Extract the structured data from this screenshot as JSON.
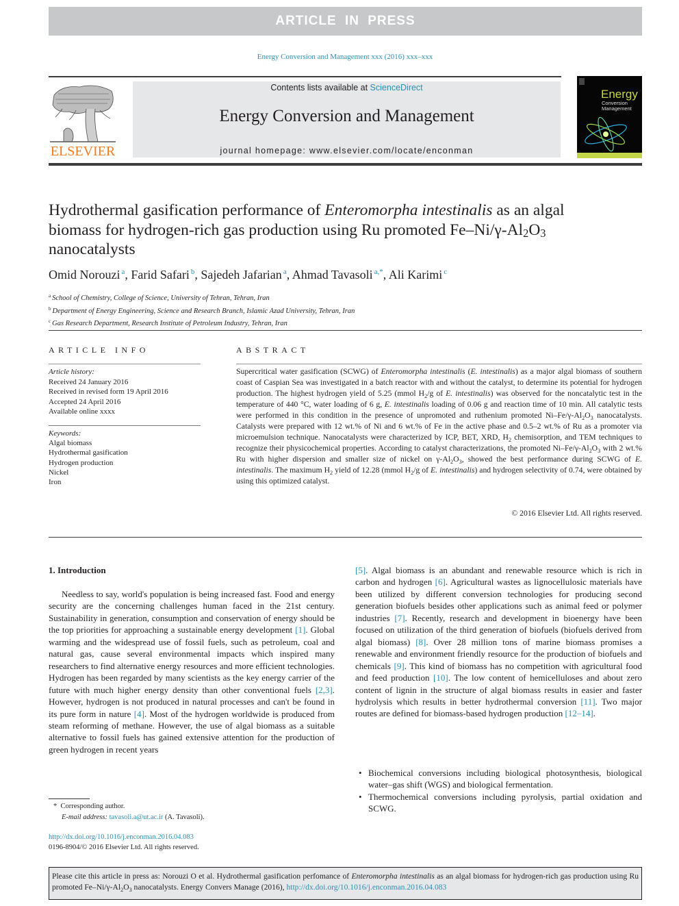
{
  "banner": "ARTICLE IN PRESS",
  "journal_ref": "Energy Conversion and Management xxx (2016) xxx–xxx",
  "header": {
    "contents_prefix": "Contents lists available at ",
    "contents_link": "ScienceDirect",
    "journal_title": "Energy Conversion and Management",
    "homepage_prefix": "journal homepage: ",
    "homepage_url": "www.elsevier.com/locate/enconman",
    "publisher_logo": "ELSEVIER",
    "cover": {
      "line1": "Energy",
      "line2": "Conversion",
      "line3": "Management"
    }
  },
  "colors": {
    "link": "#2a8fb5",
    "elsevier_orange": "#f47b20",
    "banner_gray": "#c7c8ca",
    "box_gray": "#e6e7e8"
  },
  "article": {
    "title_part1": "Hydrothermal gasification performance of ",
    "title_italic": "Enteromorpha intestinalis",
    "title_part2": " as an algal biomass for hydrogen-rich gas production using Ru promoted Fe–Ni/γ-Al",
    "title_sub1": "2",
    "title_mid": "O",
    "title_sub2": "3",
    "title_end": " nanocatalysts",
    "authors": [
      {
        "name": "Omid Norouzi",
        "aff": "a"
      },
      {
        "name": "Farid Safari",
        "aff": "b"
      },
      {
        "name": "Sajedeh Jafarian",
        "aff": "a"
      },
      {
        "name": "Ahmad Tavasoli",
        "aff": "a,*"
      },
      {
        "name": "Ali Karimi",
        "aff": "c"
      }
    ],
    "affiliations": [
      {
        "key": "a",
        "text": "School of Chemistry, College of Science, University of Tehran, Tehran, Iran"
      },
      {
        "key": "b",
        "text": "Department of Energy Engineering, Science and Research Branch, Islamic Azad University, Tehran, Iran"
      },
      {
        "key": "c",
        "text": "Gas Research Department, Research Institute of Petroleum Industry, Tehran, Iran"
      }
    ]
  },
  "article_info": {
    "heading": "ARTICLE INFO",
    "history_label": "Article history:",
    "history": [
      "Received 24 January 2016",
      "Received in revised form 19 April 2016",
      "Accepted 24 April 2016",
      "Available online xxxx"
    ],
    "keywords_label": "Keywords:",
    "keywords": [
      "Algal biomass",
      "Hydrothermal gasification",
      "Hydrogen production",
      "Nickel",
      "Iron"
    ]
  },
  "abstract": {
    "heading": "ABSTRACT",
    "copyright": "© 2016 Elsevier Ltd. All rights reserved."
  },
  "introduction": {
    "heading": "1. Introduction",
    "refs": [
      "[1]",
      "[2,3]",
      "[4]",
      "[5]",
      "[6]",
      "[7]",
      "[8]",
      "[9]",
      "[10]",
      "[11]",
      "[12–14]"
    ],
    "bullets": [
      "Biochemical conversions including biological photosynthesis, biological water–gas shift (WGS) and biological fermentation.",
      "Thermochemical conversions including pyrolysis, partial oxidation and SCWG."
    ]
  },
  "footnote": {
    "marker": "*",
    "corresponding": "Corresponding author.",
    "email_label": "E-mail address:",
    "email": "tavasoli.a@ut.ac.ir",
    "email_owner": "(A. Tavasoli).",
    "doi": "http://dx.doi.org/10.1016/j.enconman.2016.04.083",
    "issn_copyright": "0196-8904/© 2016 Elsevier Ltd. All rights reserved."
  },
  "citation_box": {
    "prefix": "Please cite this article in press as: Norouzi O et al. Hydrothermal gasification perfomance of ",
    "italic": "Enteromorpha intestinalis",
    "middle": " as an algal biomass for hydrogen-rich gas production using Ru promoted Fe–Ni/γ-Al",
    "mid2": "O",
    "suffix": " nanocatalysts. Energy Convers Manage (2016), ",
    "doi": "http://dx.doi.org/10.1016/j.enconman.2016.04.083"
  }
}
